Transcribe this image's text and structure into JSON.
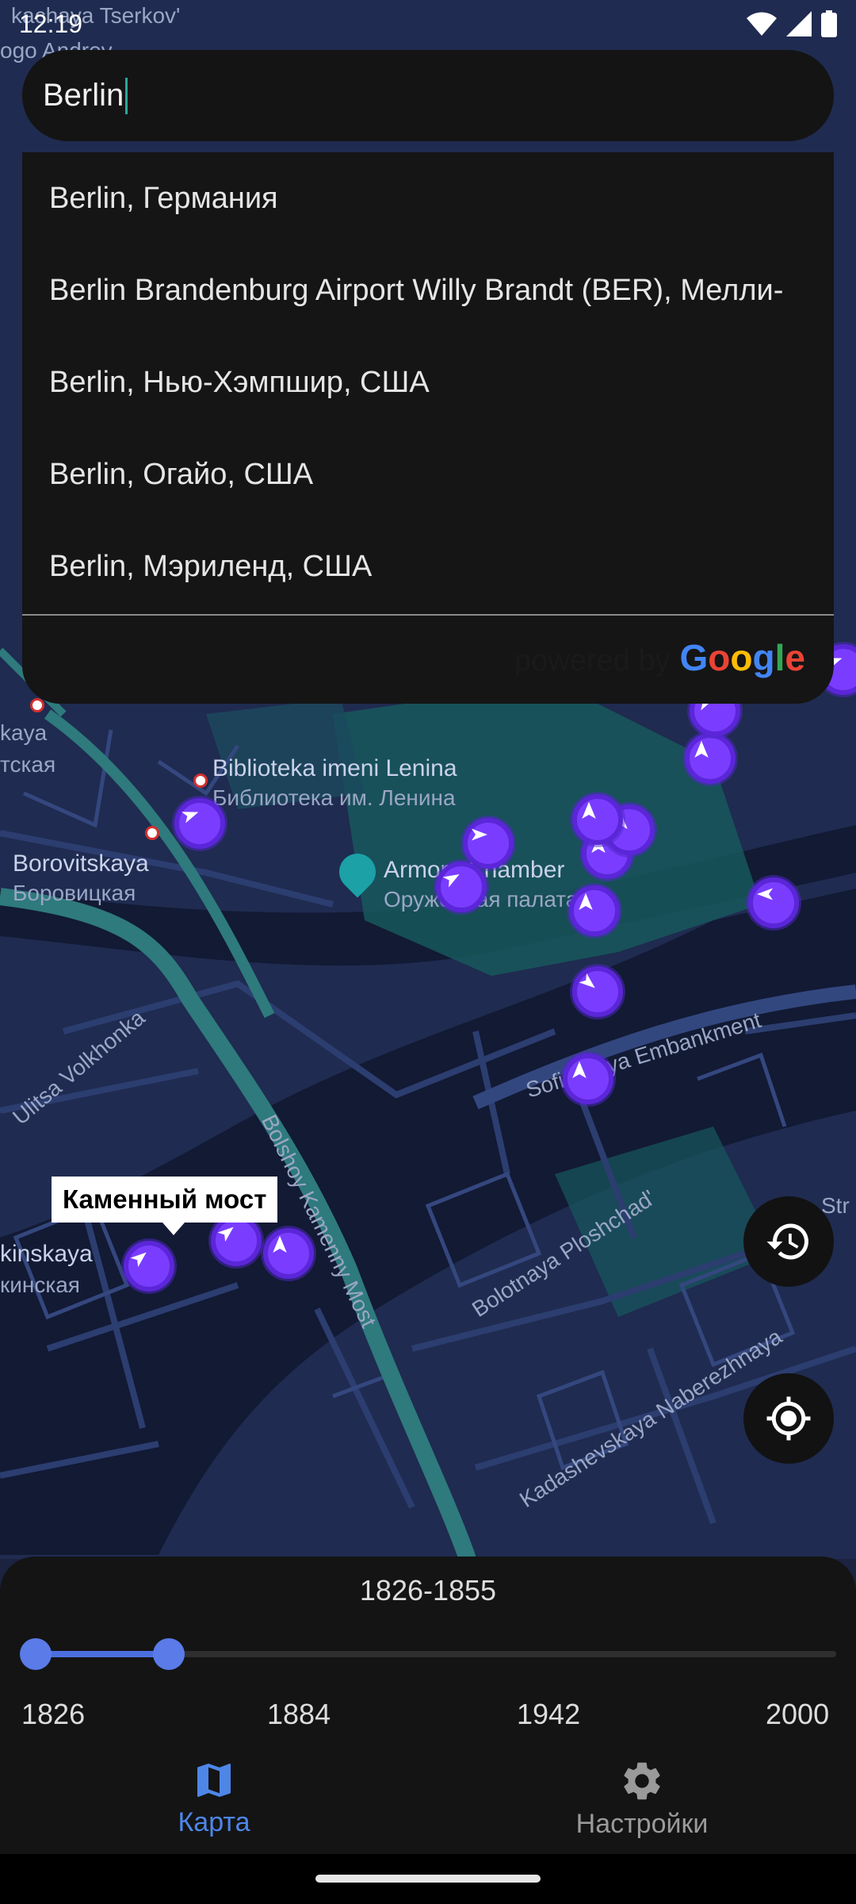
{
  "status_bar": {
    "time": "12:19"
  },
  "search": {
    "value": "Berlin"
  },
  "suggestions": [
    "Berlin, Германия",
    "Berlin Brandenburg Airport Willy Brandt (BER), Мелли-",
    "Berlin, Нью-Хэмпшир, США",
    "Berlin, Огайо, США",
    "Berlin, Мэриленд, США"
  ],
  "attribution": {
    "prefix": "powered by",
    "brand": "Google",
    "brand_colors": [
      "#4285F4",
      "#EA4335",
      "#FBBC05",
      "#4285F4",
      "#34A853",
      "#EA4335"
    ]
  },
  "map": {
    "labels": {
      "top_left_1": "kachaya Tserkov'",
      "top_left_2": "ogo Andrey",
      "kaya": "kaya",
      "tskaya": "тская",
      "biblioteka": "Biblioteka imeni Lenina",
      "biblioteka_ru": "Библиотека им. Ленина",
      "borovitskaya": "Borovitskaya",
      "borovitskaya_ru": "Боровицкая",
      "armory": "Armory Chamber",
      "armory_ru": "Оружейная палата",
      "volkhonka": "Ulitsa Volkhonka",
      "sofiyskaya": "Sofiyskaya Embankment",
      "bolshoy": "Bolshoy Kamenny Most",
      "bolotnaya": "Bolotnaya Ploshchad'",
      "kadashevskaya": "Kadashevskaya Naberezhnaya",
      "kinskaya": "kinskaya",
      "kinskaya_ru": "кинская",
      "str": "Str"
    },
    "callout": "Каменный мост"
  },
  "slider": {
    "range_label": "1826-1855",
    "min": 1826,
    "max": 2000,
    "selected_start": 1826,
    "selected_end": 1855,
    "ticks": [
      "1826",
      "1884",
      "1942",
      "2000"
    ]
  },
  "nav": {
    "map_label": "Карта",
    "settings_label": "Настройки",
    "active_color": "#4e86e8"
  },
  "icons": {
    "history": "history-icon",
    "my_location": "my-location-icon",
    "map": "map-icon",
    "settings": "gear-icon"
  }
}
